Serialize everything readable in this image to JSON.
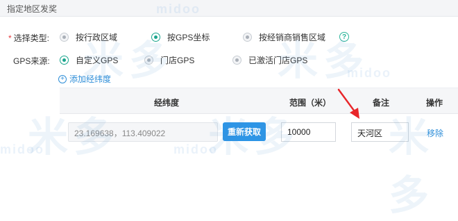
{
  "header": {
    "title": "指定地区发奖"
  },
  "select_type": {
    "label": "选择类型:",
    "required_mark": "*",
    "options": [
      {
        "label": "按行政区域",
        "checked": false
      },
      {
        "label": "按GPS坐标",
        "checked": true
      },
      {
        "label": "按经销商销售区域",
        "checked": false
      }
    ],
    "help_glyph": "?"
  },
  "gps_source": {
    "label": "GPS来源:",
    "options": [
      {
        "label": "自定义GPS",
        "checked": true
      },
      {
        "label": "门店GPS",
        "checked": false
      },
      {
        "label": "已激活门店GPS",
        "checked": false
      }
    ]
  },
  "add_coord": {
    "plus": "+",
    "label": "添加经纬度"
  },
  "table": {
    "headers": {
      "coord": "经纬度",
      "range": "范围（米）",
      "remark": "备注",
      "action": "操作"
    },
    "rows": [
      {
        "coord": "23.169638，113.409022",
        "refresh_label": "重新获取",
        "range": "10000",
        "remark": "天河区",
        "action": "移除"
      }
    ]
  },
  "watermark": {
    "brand_cn": "米多",
    "brand_en": "midoo"
  },
  "colors": {
    "accent_green": "#1aa58d",
    "link_blue": "#2e8ed8",
    "button_blue": "#2d95e6",
    "arrow_red": "#e8262a"
  }
}
